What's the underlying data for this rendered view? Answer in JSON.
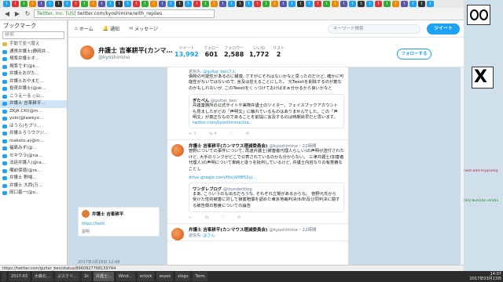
{
  "browser": {
    "tabs": [
      "t",
      "t",
      "t",
      "t",
      "t",
      "t",
      "t",
      "t",
      "t",
      "t",
      "t",
      "t",
      "t",
      "t",
      "t",
      "t",
      "t",
      "t",
      "t",
      "t",
      "t",
      "t",
      "t",
      "t",
      "t",
      "t",
      "t",
      "t",
      "t",
      "t",
      "t",
      "t",
      "t",
      "t",
      "t",
      "t",
      "t",
      "t",
      "t",
      "t",
      "t",
      "t",
      "t",
      "t",
      "t",
      "t",
      "t",
      "t",
      "t",
      "t"
    ],
    "url_site": "Twitter, Inc. [US]",
    "url": "twitter.com/kyoshimine/with_replies"
  },
  "sidebar": {
    "title": "ブックマーク",
    "search_placeholder": "検索",
    "section": "手動で並べ替え",
    "items": [
      "通貨弁護士(静岡弁…",
      "規準弁護士オ…",
      "規準です(@k…",
      "弁護士おがた…",
      "弁護士おやまだ…",
      "投資弁護士(@sk…",
      "こうえーる ◇公…",
      "弁護士 吉峯耕平…",
      "ZKJA CKI(@m…",
      "yoki(@lawkyo…",
      "ほうら(ちブリ…",
      "弁護士ろうウクジ…",
      "makoto.a(@m…",
      "福島みず(@…",
      "セキウラ(@na…",
      "法廷弁護人(@ra…",
      "備前保徳(@re…",
      "弁護士 野場…",
      "弁護士 大西(万…",
      "岡口基一(@o…"
    ],
    "selected_index": 7
  },
  "twitter_nav": {
    "home": "ホーム",
    "notifications": "通知",
    "messages": "メッセージ",
    "search_placeholder": "キーワード検索",
    "tweet_button": "ツイート"
  },
  "profile": {
    "name": "弁護士 吉峯耕平(カンマ…",
    "handle": "@kyoshimine",
    "stats": [
      {
        "label": "ツイート",
        "value": "13,992"
      },
      {
        "label": "フォロー",
        "value": "601"
      },
      {
        "label": "フォロワー",
        "value": "2,588"
      },
      {
        "label": "いいね",
        "value": "1,772"
      },
      {
        "label": "リスト",
        "value": "2"
      }
    ],
    "follow_button": "フォローする"
  },
  "left_card": {
    "name": "弁護士 吉峯耕平",
    "link": "https://twitt",
    "meta": "説明",
    "date": "2017年2月18日 12:48"
  },
  "tweets": [
    {
      "reply_to_prefix": "返信先:",
      "reply_to": "@gultar_benさん",
      "text": "偽物の可能性があるのに報復, さすがにそれはないかなと思ったのだけど, 確かに可能性がないではないので, 言及は控えることにした。 元Tweetを削除するのが筋なのかもしれないが, このTweetをくっつけておけばまぁ分かるから良いかなと",
      "quote_name": "ぎたべん",
      "quote_handle": "@gultar_ben",
      "quote_text": "弁護業務所の公式サイトや実際弁護士のツイター、フェイスブックアカウントも見ましたがどの「声明文」に触れているものはありませんでした。この「声明文」が真正なものであることを前提に言及するのは時期尚早だと思います。",
      "quote_link": "twitter.com/kyoshimine/sta…",
      "replies": "1",
      "retweets": "4",
      "likes": ""
    },
    {
      "author": "弁護士 吉峯耕平(カンマウス理減委員会)",
      "handle": "@kyoshimine",
      "time": "・22時間",
      "text": "管野についての事件について, 再逮弁護士(被害者代理人らしい)の声明が送付されたけど, 大手のリンクがどこで公表されているのかも分からない。 三津弁護士(加害者代理人)の声明について単純と違うを批判しているけど, 弁護士内容なりの有意義なことし",
      "link": "drive.google.com/file/d/0B52yj…",
      "quote_name": "ワンダレブログ",
      "quote_handle": "@lounderblog",
      "quote_text": "まあ, こういうのも出るだろうな, それぞれ立場があるからな。 管野元氏から受けた性的被害に対して損害賠償を認めた東京地裁判決(6/8)及び同判決に関する被告側の態度についての論告",
      "replies": "",
      "retweets": "",
      "likes": ""
    },
    {
      "author": "弁護士 吉峯耕平(カンマウス理減委員会)",
      "handle": "@kyoshimine",
      "time": "・22時間",
      "reply_to_prefix": "返信先:",
      "reply_to": "@さん"
    }
  ],
  "status_bar": "https://twitter.com/gultar_ben/status/8960927768159744",
  "taskbar": {
    "items": [
      "",
      "2017-03",
      "大森北…",
      "ぷスクリ…",
      "1k",
      "弁護士…",
      "Wind…",
      "xclock",
      "xoyes",
      "xlogo",
      "Term"
    ],
    "active_index": 5,
    "time": "14:07",
    "date": "2017年03月13日"
  },
  "far_right": {
    "line1": "next-add-myqrunlg.",
    "line2": "ntry-w2016c-20161"
  },
  "colors": {
    "accent": "#1da1f2",
    "bg": "#c9dbe6"
  }
}
